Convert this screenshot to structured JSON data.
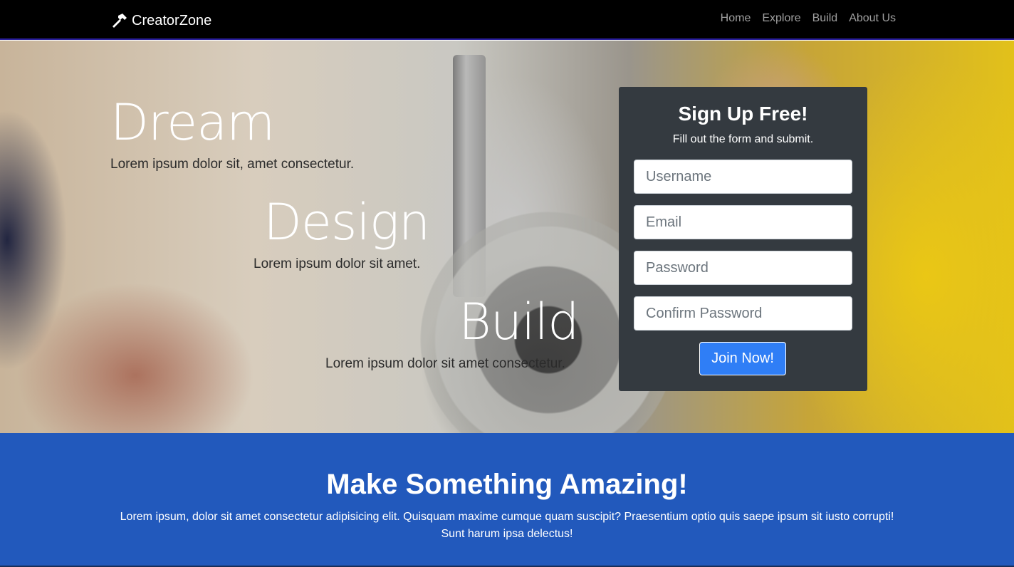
{
  "navbar": {
    "brand": "CreatorZone",
    "brand_icon": "hammer-icon",
    "links": [
      {
        "label": "Home"
      },
      {
        "label": "Explore"
      },
      {
        "label": "Build"
      },
      {
        "label": "About Us"
      }
    ]
  },
  "hero": {
    "items": [
      {
        "title": "Dream",
        "subtitle": "Lorem ipsum dolor sit, amet consectetur."
      },
      {
        "title": "Design",
        "subtitle": "Lorem ipsum dolor sit amet."
      },
      {
        "title": "Build",
        "subtitle": "Lorem ipsum dolor sit amet consectetur."
      }
    ]
  },
  "signup": {
    "title": "Sign Up Free!",
    "subtitle": "Fill out the form and submit.",
    "username_placeholder": "Username",
    "email_placeholder": "Email",
    "password_placeholder": "Password",
    "confirm_placeholder": "Confirm Password",
    "submit_label": "Join Now!"
  },
  "cta": {
    "title": "Make Something Amazing!",
    "text": "Lorem ipsum, dolor sit amet consectetur adipisicing elit. Quisquam maxime cumque quam suscipit? Praesentium optio quis saepe ipsum sit iusto corrupti! Sunt harum ipsa delectus!"
  },
  "colors": {
    "navbar_bg": "#000000",
    "card_bg": "#343a40",
    "primary_button": "#2f7ef6",
    "cta_bg": "#2259bc"
  }
}
